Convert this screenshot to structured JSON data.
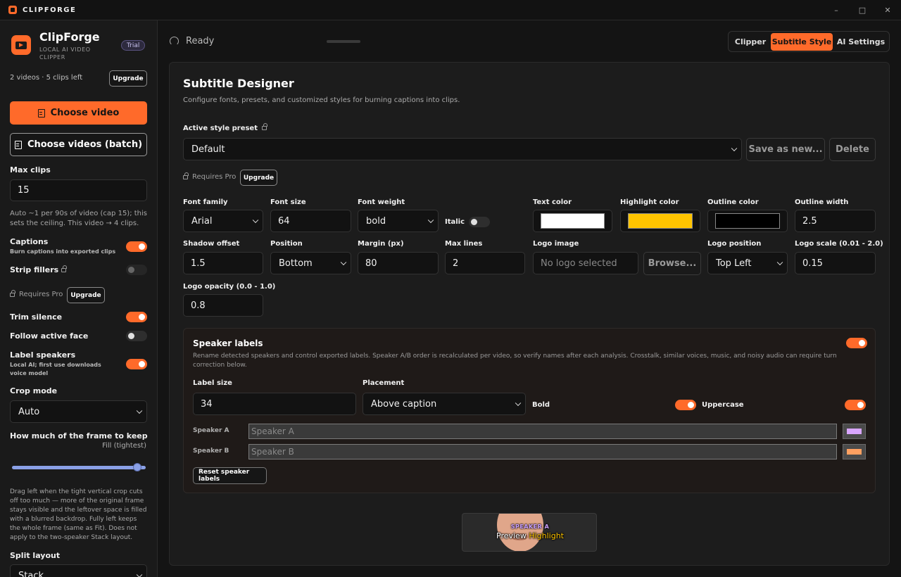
{
  "titlebar": {
    "app_name": "CLIPFORGE",
    "minimize": "–",
    "maximize": "□",
    "close": "✕"
  },
  "sidebar": {
    "brand_title": "ClipForge",
    "brand_sub": "LOCAL AI VIDEO CLIPPER",
    "trial_badge": "Trial",
    "usage": "2 videos · 5 clips left",
    "upgrade_label": "Upgrade",
    "choose_video": "Choose video",
    "choose_batch": "Choose videos (batch)",
    "max_clips_label": "Max clips",
    "max_clips_value": "15",
    "max_clips_help": "Auto ~1 per 90s of video (cap 15); this sets the ceiling. This video → 4 clips.",
    "captions_label": "Captions",
    "captions_sub": "Burn captions into exported clips",
    "captions_on": true,
    "strip_fillers_label": "Strip fillers",
    "strip_fillers_on": false,
    "requires_pro": "Requires Pro",
    "upgrade2_label": "Upgrade",
    "trim_silence_label": "Trim silence",
    "trim_silence_on": true,
    "follow_face_label": "Follow active face",
    "follow_face_on": false,
    "label_speakers_label": "Label speakers",
    "label_speakers_sub": "Local AI; first use downloads voice model",
    "label_speakers_on": true,
    "crop_mode_label": "Crop mode",
    "crop_mode_value": "Auto",
    "frame_keep_label": "How much of the frame to keep",
    "frame_keep_value": "Fill (tightest)",
    "frame_keep_slider": 0.95,
    "frame_keep_help": "Drag left when the tight vertical crop cuts off too much — more of the original frame stays visible and the leftover space is filled with a blurred backdrop. Fully left keeps the whole frame (same as Fit). Does not apply to the two-speaker Stack layout.",
    "split_layout_label": "Split layout",
    "split_layout_value": "Stack"
  },
  "header": {
    "status": "Ready",
    "tabs": [
      {
        "label": "Clipper",
        "active": false
      },
      {
        "label": "Subtitle Style",
        "active": true
      },
      {
        "label": "AI Settings",
        "active": false
      }
    ]
  },
  "designer": {
    "title": "Subtitle Designer",
    "description": "Configure fonts, presets, and customized styles for burning captions into clips.",
    "preset_label": "Active style preset",
    "preset_value": "Default",
    "save_as_new": "Save as new...",
    "delete": "Delete",
    "requires_pro": "Requires Pro",
    "upgrade_label": "Upgrade",
    "font_family_label": "Font family",
    "font_family_value": "Arial",
    "font_size_label": "Font size",
    "font_size_value": "64",
    "font_weight_label": "Font weight",
    "font_weight_value": "bold",
    "italic_label": "Italic",
    "italic_on": false,
    "text_color_label": "Text color",
    "text_color": "#ffffff",
    "highlight_color_label": "Highlight color",
    "highlight_color": "#ffc400",
    "outline_color_label": "Outline color",
    "outline_color": "#000000",
    "outline_width_label": "Outline width",
    "outline_width_value": "2.5",
    "shadow_offset_label": "Shadow offset",
    "shadow_offset_value": "1.5",
    "position_label": "Position",
    "position_value": "Bottom",
    "margin_label": "Margin (px)",
    "margin_value": "80",
    "max_lines_label": "Max lines",
    "max_lines_value": "2",
    "logo_image_label": "Logo image",
    "logo_image_placeholder": "No logo selected",
    "browse_label": "Browse...",
    "logo_position_label": "Logo position",
    "logo_position_value": "Top Left",
    "logo_scale_label": "Logo scale (0.01 - 2.0)",
    "logo_scale_value": "0.15",
    "logo_opacity_label": "Logo opacity (0.0 - 1.0)",
    "logo_opacity_value": "0.8"
  },
  "speakers": {
    "title": "Speaker labels",
    "enabled": true,
    "description": "Rename detected speakers and control exported labels. Speaker A/B order is recalculated per video, so verify names after each analysis. Crosstalk, similar voices, music, and noisy audio can require turn correction below.",
    "label_size_label": "Label size",
    "label_size_value": "34",
    "placement_label": "Placement",
    "placement_value": "Above caption",
    "bold_label": "Bold",
    "bold_on": true,
    "uppercase_label": "Uppercase",
    "uppercase_on": true,
    "rows": [
      {
        "label": "Speaker A",
        "placeholder": "Speaker A",
        "color": "#d9a6ff"
      },
      {
        "label": "Speaker B",
        "placeholder": "Speaker B",
        "color": "#ffa061"
      }
    ],
    "reset_label": "Reset speaker labels"
  },
  "preview": {
    "speaker_tag": "SPEAKER A",
    "text_before": "Preview ",
    "text_highlight": "Highlight"
  }
}
